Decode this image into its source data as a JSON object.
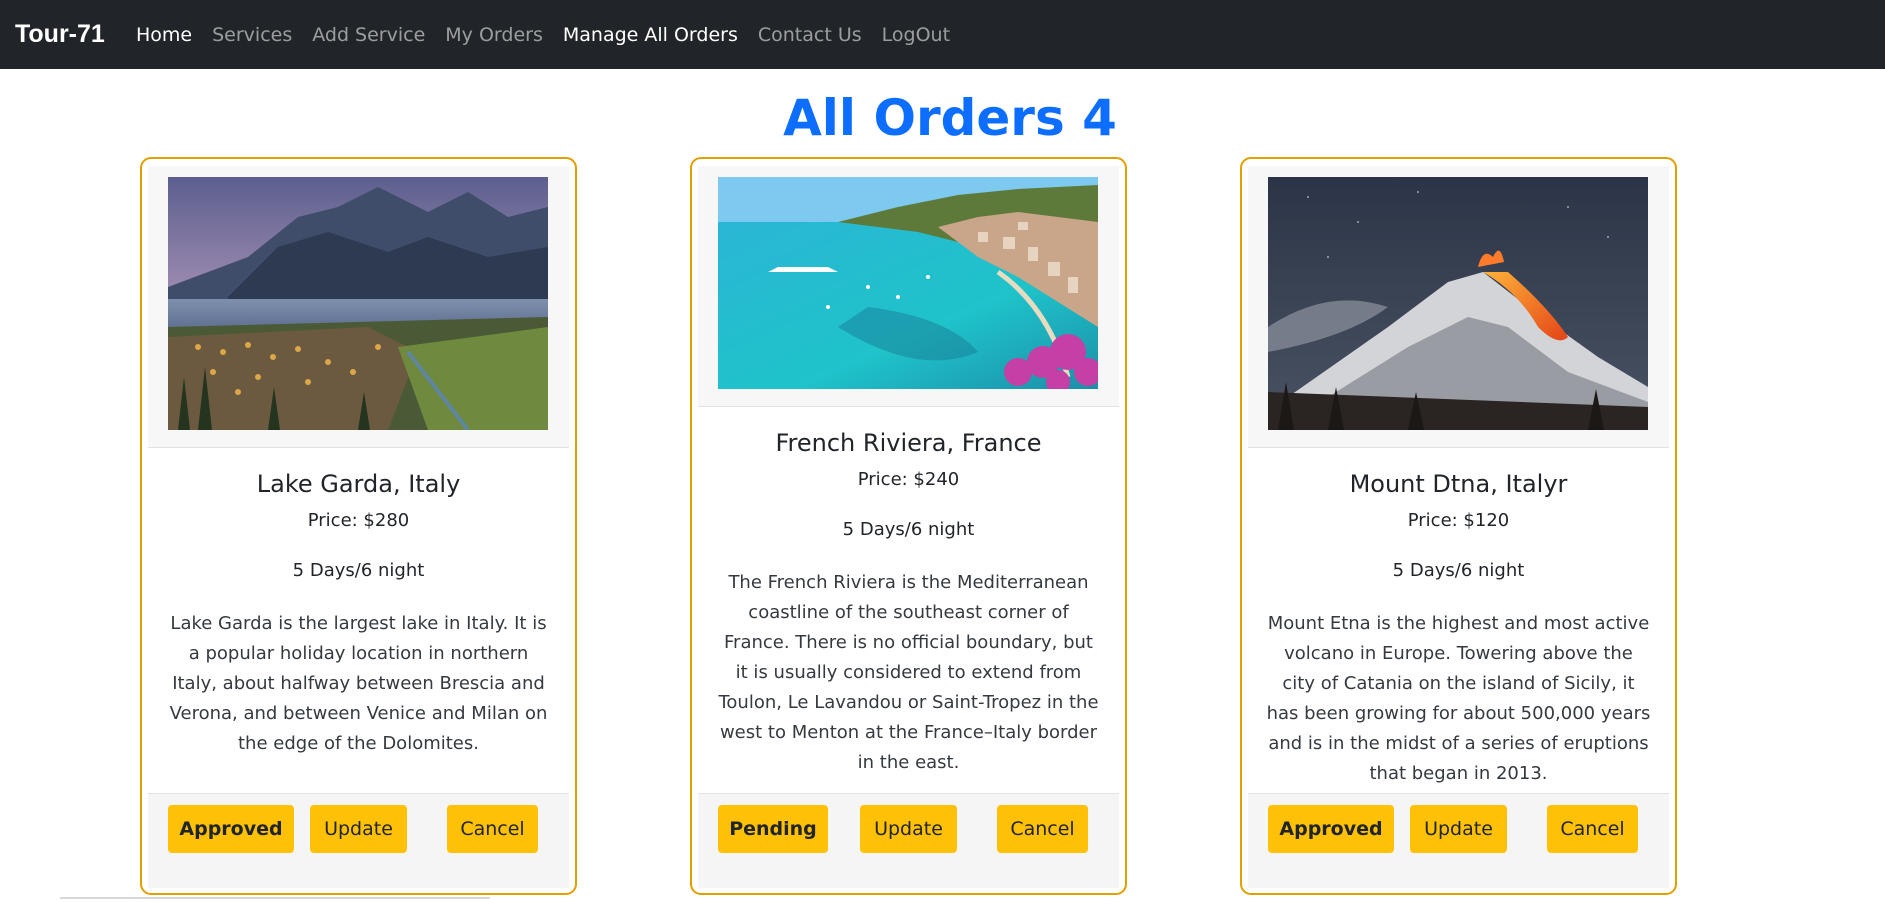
{
  "nav": {
    "brand": "Tour-71",
    "links": [
      {
        "label": "Home"
      },
      {
        "label": "Services"
      },
      {
        "label": "Add Service"
      },
      {
        "label": "My Orders"
      },
      {
        "label": "Manage All Orders"
      },
      {
        "label": "Contact Us"
      },
      {
        "label": "LogOut"
      }
    ]
  },
  "page": {
    "title": "All Orders 4"
  },
  "orders": [
    {
      "title": "Lake Garda, Italy",
      "price": "Price: $280",
      "duration": "5 Days/6 night",
      "description": "Lake Garda is the largest lake in Italy. It is a popular holiday location in northern Italy, about halfway between Brescia and Verona, and between Venice and Milan on the edge of the Dolomites.",
      "status": "Approved",
      "update_label": "Update",
      "cancel_label": "Cancel",
      "image": "lake-landscape-photo"
    },
    {
      "title": "French Riviera, France",
      "price": "Price: $240",
      "duration": "5 Days/6 night",
      "description": "The French Riviera is the Mediterranean coastline of the southeast corner of France. There is no official boundary, but it is usually considered to extend from Toulon, Le Lavandou or Saint-Tropez in the west to Menton at the France–Italy border in the east.",
      "status": "Pending",
      "update_label": "Update",
      "cancel_label": "Cancel",
      "image": "coastline-photo"
    },
    {
      "title": "Mount Dtna, Italyr",
      "price": "Price: $120",
      "duration": "5 Days/6 night",
      "description": "Mount Etna is the highest and most active volcano in Europe. Towering above the city of Catania on the island of Sicily, it has been growing for about 500,000 years and is in the midst of a series of eruptions that began in 2013.",
      "status": "Approved",
      "update_label": "Update",
      "cancel_label": "Cancel",
      "image": "volcano-photo"
    }
  ],
  "colors": {
    "navbar": "#212529",
    "title": "#0d6efd",
    "card_border": "#e0a000",
    "button": "#ffc107"
  }
}
